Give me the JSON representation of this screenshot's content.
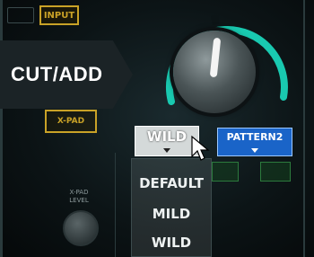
{
  "header": {
    "input_tag": "INPUT"
  },
  "effect": {
    "name": "CUT/ADD"
  },
  "xpad": {
    "label": "X-PAD",
    "level_label": "X-PAD LEVEL"
  },
  "mode_dropdown": {
    "selected": "WILD",
    "options": [
      "DEFAULT",
      "MILD",
      "WILD"
    ]
  },
  "pattern_dropdown": {
    "selected": "PATTERN2"
  },
  "colors": {
    "knob_ring": "#19c9b0",
    "tag_border": "#c9a227",
    "pattern_bg": "#1a64c8"
  }
}
